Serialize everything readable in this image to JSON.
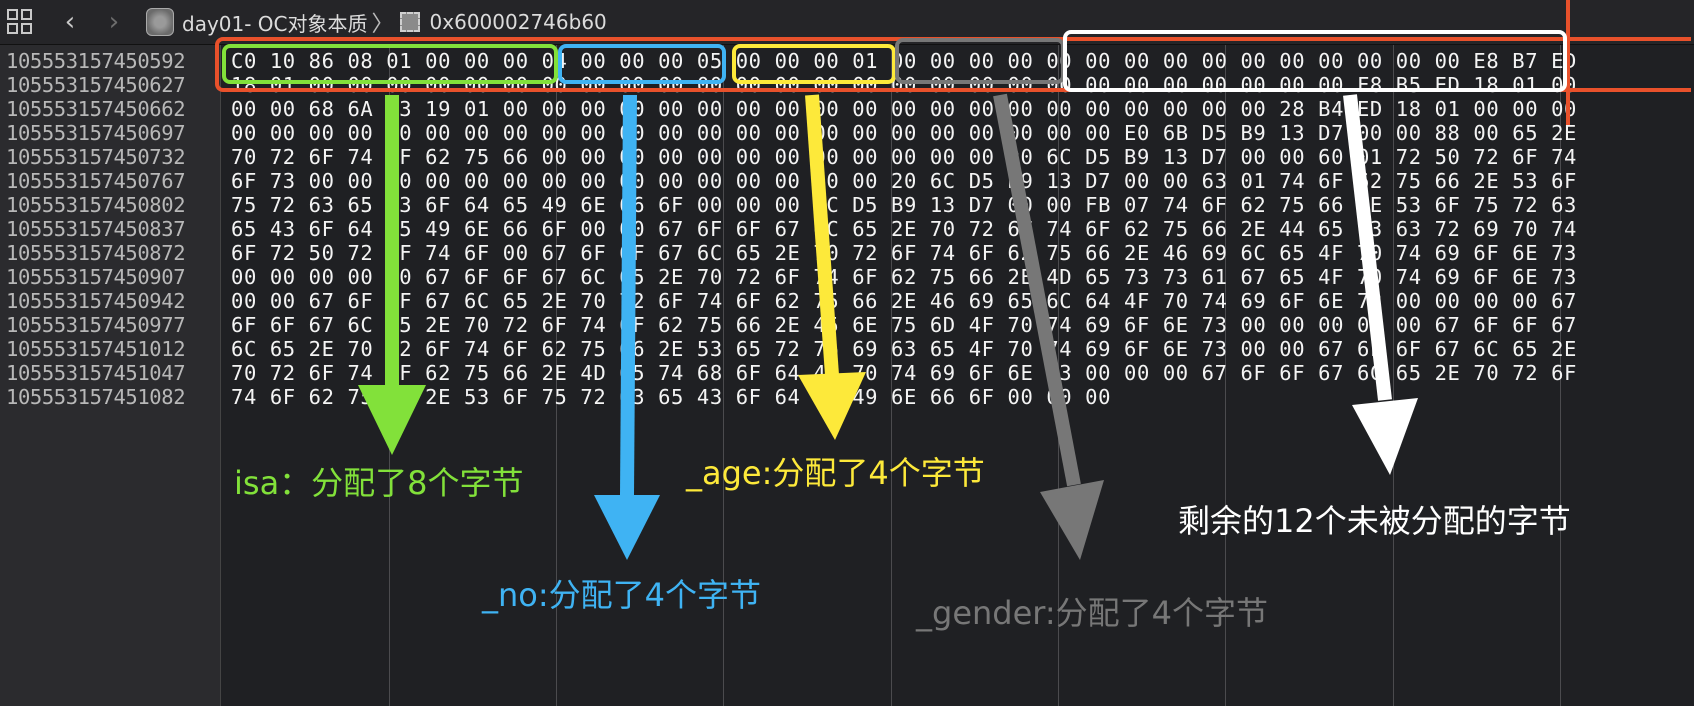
{
  "toolbar": {
    "crumb_project": "day01- OC对象本质",
    "crumb_separator": "〉",
    "crumb_address": "0x600002746b60"
  },
  "icons": {
    "grid": "grid-icon",
    "back": "chevron-left-icon",
    "forward": "chevron-right-icon",
    "project": "project-icon",
    "memory": "memory-chip-icon"
  },
  "memory": {
    "addresses": [
      "105553157450592",
      "105553157450627",
      "105553157450662",
      "105553157450697",
      "105553157450732",
      "105553157450767",
      "105553157450802",
      "105553157450837",
      "105553157450872",
      "105553157450907",
      "105553157450942",
      "105553157450977",
      "105553157451012",
      "105553157451047",
      "105553157451082"
    ],
    "rows": [
      "C0 10 86 08 01 00 00 00 04 00 00 00 05 00 00 00 01 00 00 00 00 00 00 00 00 00 00 00 00 00 00 00 E8 B7 ED",
      "18 01 00 00 00 00 00 00 00 00 00 00 00 00 00 00 00 00 00 00 00 00 00 00 00 00 00 00 00 F8 B5 ED 18 01 00",
      "00 00 68 6A 23 19 01 00 00 00 00 00 00 00 00 00 00 00 00 00 00 00 00 00 00 00 00 28 B4 ED 18 01 00 00 00",
      "00 00 00 00 00 00 00 00 00 00 00 00 00 00 00 00 00 00 00 00 00 00 00 E0 6B D5 B9 13 D7 00 00 88 00 65 2E",
      "70 72 6F 74 6F 62 75 66 00 00 00 00 00 00 00 00 00 00 00 00 00 6C D5 B9 13 D7 00 00 60 01 72 50 72 6F 74",
      "6F 73 00 00 00 00 00 00 00 00 00 00 00 00 00 00 00 20 6C D5 B9 13 D7 00 00 63 01 74 6F 62 75 66 2E 53 6F",
      "75 72 63 65 43 6F 64 65 49 6E 66 6F 00 00 00 6C D5 B9 13 D7 00 00 FB 07 74 6F 62 75 66 2E 53 6F 75 72 63",
      "65 43 6F 64 65 49 6E 66 6F 00 00 67 6F 6F 67 6C 65 2E 70 72 6F 74 6F 62 75 66 2E 44 65 73 63 72 69 70 74",
      "6F 72 50 72 6F 74 6F 00 67 6F 6F 67 6C 65 2E 70 72 6F 74 6F 62 75 66 2E 46 69 6C 65 4F 70 74 69 6F 6E 73",
      "00 00 00 00 00 67 6F 6F 67 6C 65 2E 70 72 6F 74 6F 62 75 66 2E 4D 65 73 73 61 67 65 4F 70 74 69 6F 6E 73",
      "00 00 67 6F 6F 67 6C 65 2E 70 72 6F 74 6F 62 75 66 2E 46 69 65 6C 64 4F 70 74 69 6F 6E 73 00 00 00 00 67",
      "6F 6F 67 6C 65 2E 70 72 6F 74 6F 62 75 66 2E 45 6E 75 6D 4F 70 74 69 6F 6E 73 00 00 00 00 00 67 6F 6F 67",
      "6C 65 2E 70 72 6F 74 6F 62 75 66 2E 53 65 72 76 69 63 65 4F 70 74 69 6F 6E 73 00 00 67 6F 6F 67 6C 65 2E",
      "70 72 6F 74 6F 62 75 66 2E 4D 65 74 68 6F 64 4F 70 74 69 6F 6E 73 00 00 00 67 6F 6F 67 6C 65 2E 70 72 6F",
      "74 6F 62 75 66 2E 53 6F 75 72 63 65 43 6F 64 65 49 6E 66 6F 00 00 00"
    ]
  },
  "annotations": {
    "isa": "isa：分配了8个字节",
    "no": "_no:分配了4个字节",
    "age": "_age:分配了4个字节",
    "gender": "_gender:分配了4个字节",
    "remaining": "剩余的12个未被分配的字节",
    "colors": {
      "outer": "#e8512b",
      "isa": "#82e13a",
      "no": "#3fb3f3",
      "age": "#fde93a",
      "gender": "#777777",
      "remaining": "#ffffff"
    }
  }
}
